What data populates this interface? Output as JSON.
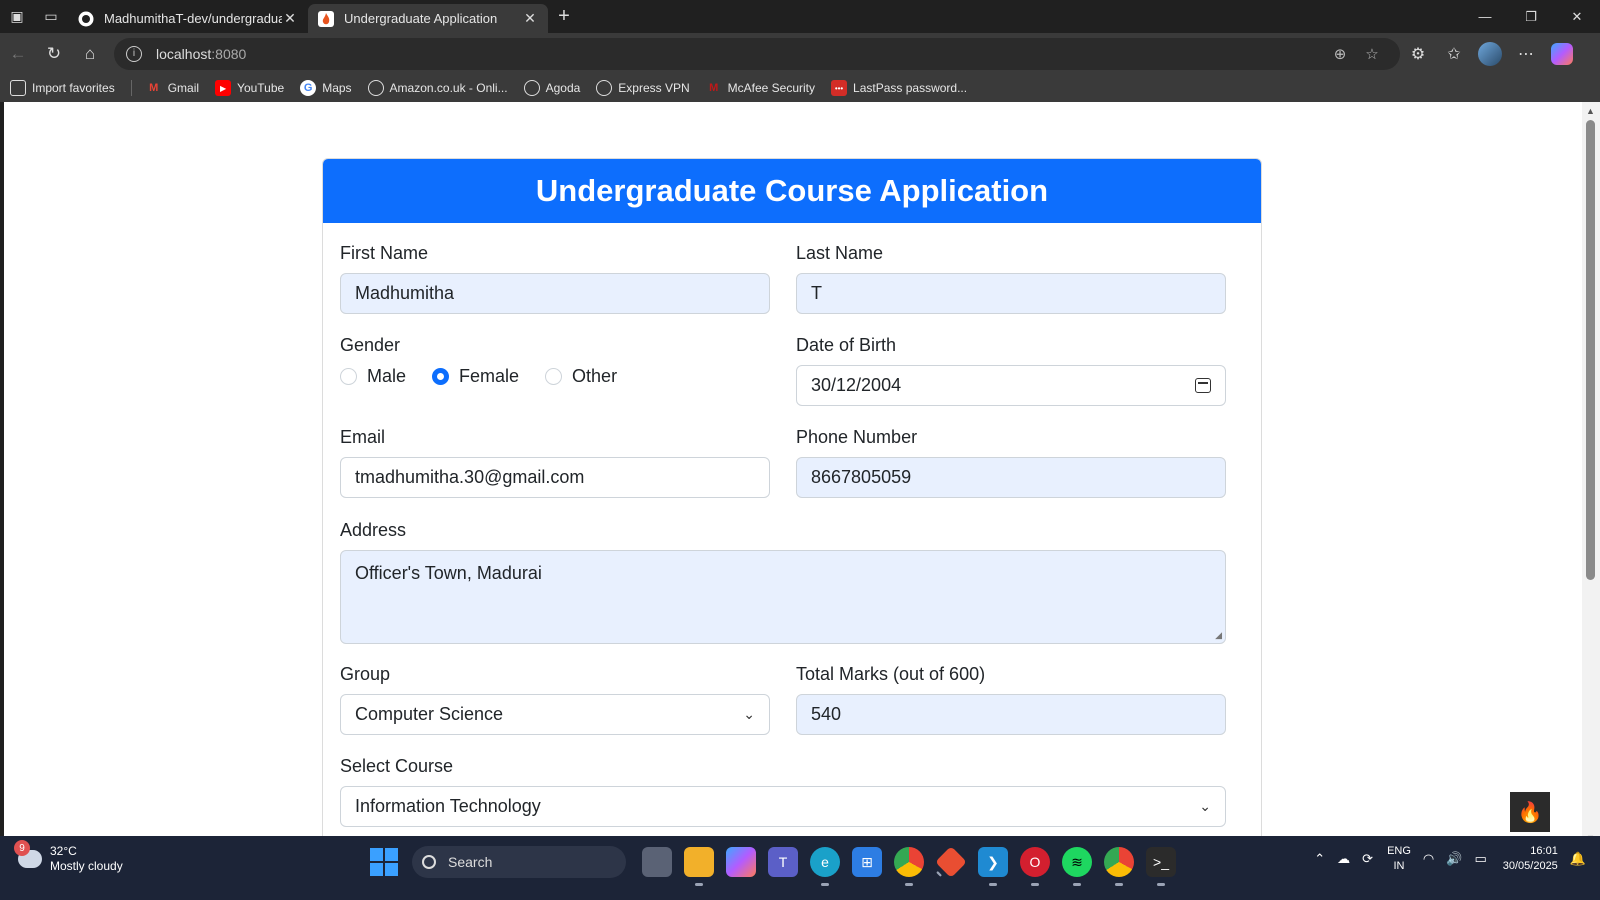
{
  "browser": {
    "tabs": [
      {
        "title": "MadhumithaT-dev/undergraduat",
        "active": false
      },
      {
        "title": "Undergraduate Application",
        "active": true
      }
    ],
    "address": {
      "host": "localhost",
      "port": ":8080"
    },
    "favorites": [
      {
        "label": "Import favorites",
        "icon": "import-icon"
      },
      {
        "label": "Gmail",
        "icon": "gmail-icon"
      },
      {
        "label": "YouTube",
        "icon": "youtube-icon"
      },
      {
        "label": "Maps",
        "icon": "google-icon"
      },
      {
        "label": "Amazon.co.uk - Onli...",
        "icon": "globe-icon"
      },
      {
        "label": "Agoda",
        "icon": "globe-icon"
      },
      {
        "label": "Express VPN",
        "icon": "globe-icon"
      },
      {
        "label": "McAfee Security",
        "icon": "mcafee-icon"
      },
      {
        "label": "LastPass password...",
        "icon": "lastpass-icon"
      }
    ]
  },
  "form": {
    "title": "Undergraduate Course Application",
    "first_name": {
      "label": "First Name",
      "value": "Madhumitha"
    },
    "last_name": {
      "label": "Last Name",
      "value": "T"
    },
    "gender": {
      "label": "Gender",
      "options": [
        "Male",
        "Female",
        "Other"
      ],
      "selected": "Female"
    },
    "dob": {
      "label": "Date of Birth",
      "value": "30/12/2004"
    },
    "email": {
      "label": "Email",
      "value": "tmadhumitha.30@gmail.com"
    },
    "phone": {
      "label": "Phone Number",
      "value": "8667805059"
    },
    "address": {
      "label": "Address",
      "value": "Officer's Town, Madurai"
    },
    "group": {
      "label": "Group",
      "value": "Computer Science"
    },
    "total_marks": {
      "label": "Total Marks (out of 600)",
      "value": "540"
    },
    "course": {
      "label": "Select Course",
      "value": "Information Technology"
    }
  },
  "taskbar": {
    "weather": {
      "temp": "32°C",
      "desc": "Mostly cloudy",
      "badge": "9"
    },
    "search_label": "Search",
    "lang": {
      "line1": "ENG",
      "line2": "IN"
    },
    "clock": {
      "time": "16:01",
      "date": "30/05/2025"
    }
  },
  "colors": {
    "accent": "#0d6efd",
    "autofill": "#e8f0fe"
  }
}
